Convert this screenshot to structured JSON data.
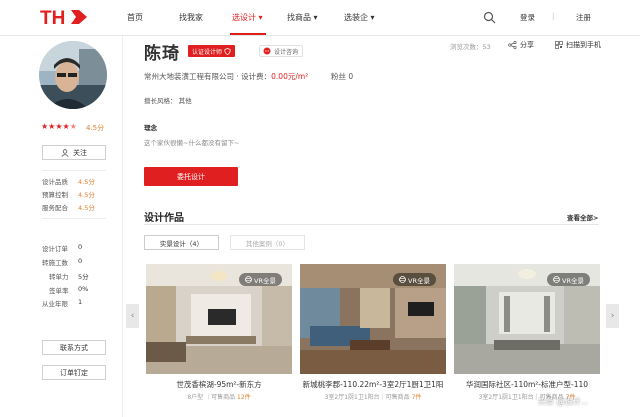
{
  "header": {
    "logo_text": "THD",
    "nav": [
      "首页",
      "找我家",
      "选设计",
      "找商品",
      "选装企"
    ],
    "login": "登录",
    "separator": "|",
    "register": "注册"
  },
  "sidebar": {
    "rating": "4.5分",
    "follow": "关注",
    "scores": [
      {
        "label": "设计品质",
        "value": "4.5分"
      },
      {
        "label": "预算控制",
        "value": "4.5分"
      },
      {
        "label": "服务配合",
        "value": "4.5分"
      }
    ],
    "orders": [
      {
        "label": "设计订单",
        "value": "0"
      },
      {
        "label": "转施工数",
        "value": "0"
      },
      {
        "label": "转单力",
        "value": "5分"
      },
      {
        "label": "签单率",
        "value": "0%"
      },
      {
        "label": "从业年限",
        "value": "1"
      }
    ],
    "contact": "联系方式",
    "order_now": "订单钉定"
  },
  "profile": {
    "name": "陈琦",
    "cert": "认证设计师",
    "consult": "设计咨询",
    "views": "浏览次数：53",
    "share": "分享",
    "scan": "扫描到手机",
    "company": "常州大地装潢工程有限公司 · 设计费：",
    "fee": "0.00元/m²",
    "fans": "粉丝 0",
    "style": "擅长风格：   其他",
    "idea_title": "理念",
    "idea_text": "这个家伙很懒~什么都没有留下~",
    "commission": "委托设计"
  },
  "works": {
    "title": "设计作品",
    "view_all": "查看全部>",
    "tabs": [
      "实景设计（4）",
      "其他案例（0）"
    ],
    "vr_label": "VR全景",
    "cards": [
      {
        "title": "世茂香槟湖-95m²-新东方",
        "sub_prefix": "8户型 ｜可售商品 ",
        "count": "12件"
      },
      {
        "title": "新城桃李郡-110.22m²-3室2厅1厨1卫1阳",
        "sub_prefix": "3室2厅1厨1卫1阳台｜可售商品 ",
        "count": "7件"
      },
      {
        "title": "华润国际社区-110m²-标准户型-110",
        "sub_prefix": "3室2厅1厨1卫1阳台｜可售商品 ",
        "count": "7件"
      }
    ]
  },
  "watermark": "头条 @设计..."
}
